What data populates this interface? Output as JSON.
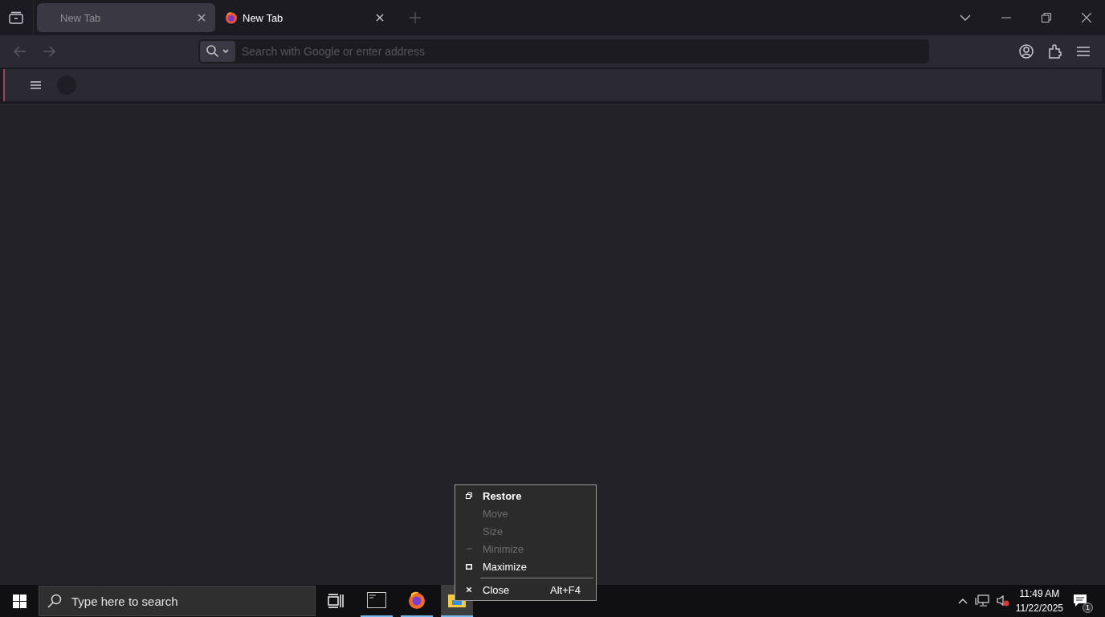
{
  "tabs": [
    {
      "label": "New Tab",
      "selected": true,
      "favicon": false
    },
    {
      "label": "New Tab",
      "selected": false,
      "favicon": true
    }
  ],
  "address": {
    "placeholder": "Search with Google or enter address"
  },
  "context_menu": {
    "items": [
      {
        "kind": "restore",
        "label": "Restore",
        "default": true,
        "disabled": false
      },
      {
        "kind": "plain",
        "label": "Move",
        "default": false,
        "disabled": true
      },
      {
        "kind": "plain",
        "label": "Size",
        "default": false,
        "disabled": true
      },
      {
        "kind": "minimize",
        "label": "Minimize",
        "default": false,
        "disabled": true
      },
      {
        "kind": "maximize",
        "label": "Maximize",
        "default": false,
        "disabled": false
      },
      {
        "kind": "separator"
      },
      {
        "kind": "close",
        "label": "Close",
        "default": false,
        "disabled": false,
        "shortcut": "Alt+F4"
      }
    ]
  },
  "taskbar": {
    "search": {
      "placeholder": "Type here to search"
    },
    "apps": [
      {
        "kind": "terminal",
        "running": true,
        "selected": false
      },
      {
        "kind": "browser",
        "running": true,
        "selected": false
      },
      {
        "kind": "folder",
        "running": true,
        "selected": true
      }
    ],
    "time": "11:49 AM",
    "date": "11/22/2025",
    "notifications": "1"
  }
}
